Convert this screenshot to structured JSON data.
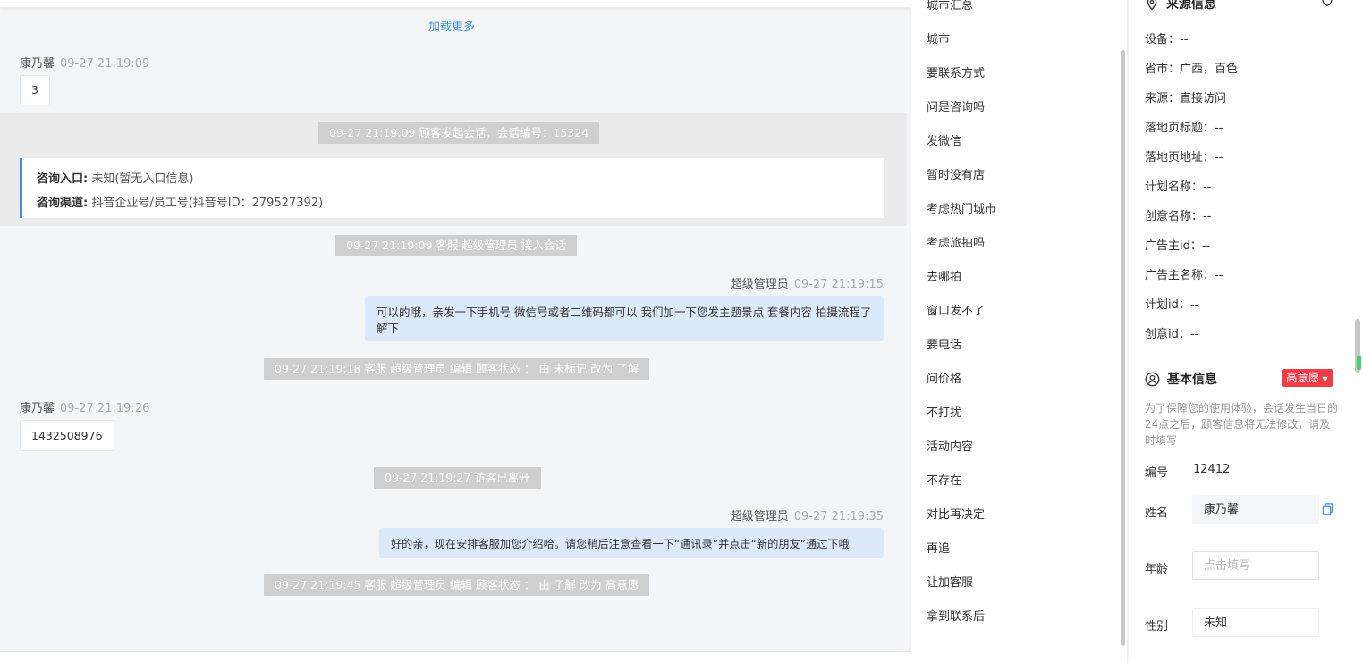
{
  "chat": {
    "load_more": "加载更多",
    "messages": [
      {
        "sender": "康乃馨",
        "time": "09-27 21:19:09",
        "text": "3"
      },
      {
        "system": "09-27 21:19:09 顾客发起会话，会话编号：15324"
      },
      {
        "entry_label": "咨询入口:",
        "entry_value": "未知(暂无入口信息)",
        "channel_label": "咨询渠道:",
        "channel_value": "抖音企业号/员工号(抖音号ID：279527392)"
      },
      {
        "system": "09-27 21:19:09 客服 超级管理员 接入会话"
      },
      {
        "sender": "超级管理员",
        "time": "09-27 21:19:15",
        "text": "可以的哦，亲发一下手机号 微信号或者二维码都可以 我们加一下您发主题景点 套餐内容 拍摄流程了解下"
      },
      {
        "system": "09-27 21:19:18 客服 超级管理员 编辑 顾客状态 ： 由 未标记 改为 了解"
      },
      {
        "sender": "康乃馨",
        "time": "09-27 21:19:26",
        "text": "1432508976"
      },
      {
        "system": "09-27 21:19:27 访客已离开"
      },
      {
        "sender": "超级管理员",
        "time": "09-27 21:19:35",
        "text": "好的亲，现在安排客服加您介绍哈。请您稍后注意查看一下“通讯录”并点击“新的朋友”通过下哦"
      },
      {
        "system": "09-27 21:19:45 客服 超级管理员 编辑 顾客状态 ： 由 了解 改为 高意愿"
      }
    ]
  },
  "quick_replies": [
    "城市汇总",
    "城市",
    "要联系方式",
    "问是咨询吗",
    "发微信",
    "暂时没有店",
    "考虑热门城市",
    "考虑旅拍吗",
    "去哪拍",
    "窗口发不了",
    "要电话",
    "问价格",
    "不打扰",
    "活动内容",
    "不存在",
    "对比再决定",
    "再追",
    "让加客服",
    "拿到联系后"
  ],
  "source_info": {
    "title": "来源信息",
    "rows": [
      "设备：--",
      "省市：广西，百色",
      "来源：直接访问",
      "落地页标题：--",
      "落地页地址：--",
      "计划名称：--",
      "创意名称：--",
      "广告主id：--",
      "广告主名称：--",
      "计划id：--",
      "创意id：--"
    ]
  },
  "basic_info": {
    "title": "基本信息",
    "intent_badge": "高意愿",
    "note": "为了保障您的使用体验，会话发生当日的24点之后，顾客信息将无法修改，请及时填写",
    "id_label": "编号",
    "id_value": "12412",
    "name_label": "姓名",
    "name_value": "康乃馨",
    "age_label": "年龄",
    "age_placeholder": "点击填写",
    "gender_label": "性别",
    "gender_value": "未知"
  },
  "colors": {
    "accent": "#3f8fe8",
    "badge": "#f23b45",
    "outgoing_bubble": "#dce9fb",
    "system_tag": "#cfcfcf"
  }
}
